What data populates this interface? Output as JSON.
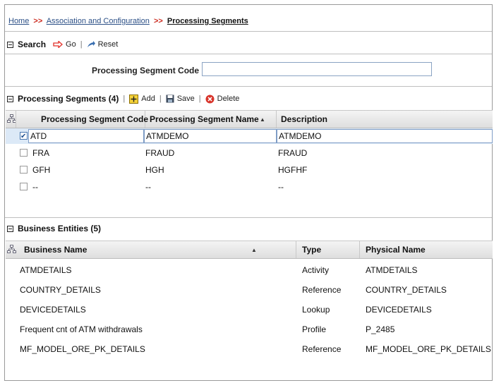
{
  "breadcrumb": {
    "home": "Home",
    "sep": ">>",
    "association": "Association and Configuration",
    "current": "Processing Segments"
  },
  "search": {
    "title": "Search",
    "go_label": "Go",
    "reset_label": "Reset",
    "field_label": "Processing Segment Code",
    "field_value": "",
    "field_placeholder": ""
  },
  "segments": {
    "title": "Processing Segments (4)",
    "add_label": "Add",
    "save_label": "Save",
    "delete_label": "Delete",
    "columns": {
      "code": "Processing Segment Code",
      "name": "Processing Segment Name",
      "description": "Description"
    },
    "rows": [
      {
        "code": "ATD",
        "name": "ATMDEMO",
        "description": "ATMDEMO",
        "checked": true
      },
      {
        "code": "FRA",
        "name": "FRAUD",
        "description": "FRAUD",
        "checked": false
      },
      {
        "code": "GFH",
        "name": "HGH",
        "description": "HGFHF",
        "checked": false
      },
      {
        "code": "--",
        "name": "--",
        "description": "--",
        "checked": false
      }
    ]
  },
  "entities": {
    "title": "Business Entities (5)",
    "columns": {
      "business_name": "Business Name",
      "type": "Type",
      "physical_name": "Physical Name"
    },
    "rows": [
      {
        "business_name": "ATMDETAILS",
        "type": "Activity",
        "physical_name": "ATMDETAILS"
      },
      {
        "business_name": "COUNTRY_DETAILS",
        "type": "Reference",
        "physical_name": "COUNTRY_DETAILS"
      },
      {
        "business_name": "DEVICEDETAILS",
        "type": "Lookup",
        "physical_name": "DEVICEDETAILS"
      },
      {
        "business_name": "Frequent cnt of ATM withdrawals",
        "type": "Profile",
        "physical_name": "P_2485"
      },
      {
        "business_name": "MF_MODEL_ORE_PK_DETAILS",
        "type": "Reference",
        "physical_name": "MF_MODEL_ORE_PK_DETAILS"
      }
    ]
  },
  "icons": {
    "go": "arrow-right-icon",
    "reset": "reset-icon",
    "add": "add-icon",
    "save": "save-icon",
    "delete": "delete-icon",
    "tree": "tree-icon",
    "sort": "sort-ascending-icon"
  },
  "colors": {
    "link": "#2b4f86",
    "separator": "#cc2a1e",
    "go_arrow": "#e2312a",
    "selected_row": "#dce9f7",
    "header_bg": "#e6e6e6"
  }
}
